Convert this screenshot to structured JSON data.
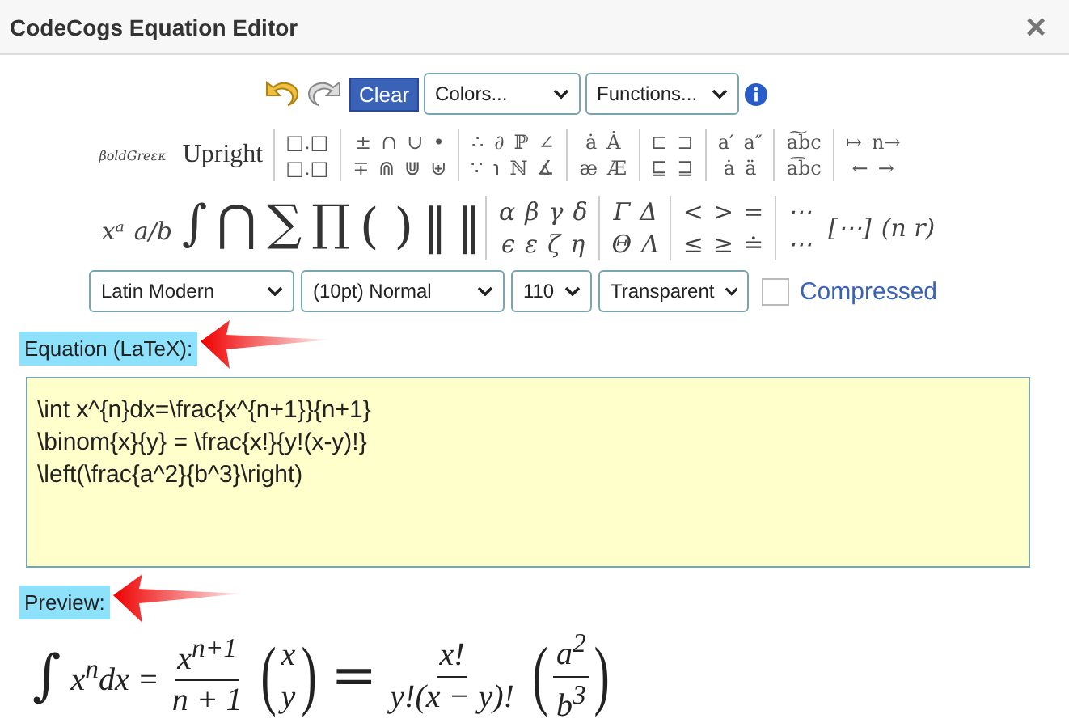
{
  "window": {
    "title": "CodeCogs Equation Editor",
    "close": "×"
  },
  "toolbar": {
    "clear": "Clear",
    "menus": [
      "Colors...",
      "Functions..."
    ]
  },
  "style_buttons": [
    {
      "text": "βoldGreεκ",
      "kind": "small"
    },
    {
      "text": "Upright",
      "kind": "serif"
    }
  ],
  "symbol_groups": [
    {
      "rows": [
        [
          "□.□"
        ],
        [
          "□.□"
        ]
      ]
    },
    {
      "rows": [
        [
          "±",
          "∩",
          "∪",
          "•"
        ],
        [
          "∓",
          "⋒",
          "⋓",
          "⊎"
        ]
      ]
    },
    {
      "rows": [
        [
          "∴",
          "∂",
          "ℙ",
          "∠"
        ],
        [
          "∵",
          "℩",
          "ℕ",
          "∡"
        ]
      ]
    },
    {
      "rows": [
        [
          "ȧ",
          "Ȧ"
        ],
        [
          "æ",
          "Æ"
        ]
      ]
    },
    {
      "rows": [
        [
          "⊏",
          "⊐"
        ],
        [
          "⊑",
          "⊒"
        ]
      ]
    },
    {
      "rows": [
        [
          "a′",
          "a″"
        ],
        [
          "ȧ",
          "ä"
        ]
      ]
    },
    {
      "rows": [
        [
          "a͠bc"
        ],
        [
          "a͡bc"
        ]
      ]
    },
    {
      "rows": [
        [
          "↦",
          "n→"
        ],
        [
          "←",
          "→"
        ]
      ]
    }
  ],
  "big_groups": [
    {
      "items": [
        "xᵃ",
        "a/b",
        "∫",
        "⋂",
        "∑",
        "∏"
      ]
    },
    {
      "items": [
        "( )",
        "‖",
        "‖"
      ]
    },
    {
      "rows": [
        [
          "α",
          "β",
          "γ",
          "δ"
        ],
        [
          "ϵ",
          "ε",
          "ζ",
          "η"
        ]
      ]
    },
    {
      "rows": [
        [
          "Γ",
          "Δ"
        ],
        [
          "Θ",
          "Λ"
        ]
      ]
    },
    {
      "rows": [
        [
          "<",
          ">",
          "="
        ],
        [
          "≤",
          "≥",
          "≐"
        ]
      ]
    },
    {
      "rows": [
        [
          "⋯"
        ],
        [
          "⋯"
        ]
      ]
    },
    {
      "items": [
        "[⋯]",
        "(n r)"
      ]
    }
  ],
  "format": {
    "selects": [
      "Latin Modern",
      "(10pt) Normal",
      "110",
      "Transparent"
    ],
    "compressed": {
      "label": "Compressed",
      "checked": false
    }
  },
  "equation": {
    "label": "Equation (LaTeX):",
    "value": "\\int x^{n}dx=\\frac{x^{n+1}}{n+1}\n\\binom{x}{y} = \\frac{x!}{y!(x-y)!}\n\\left(\\frac{a^2}{b^3}\\right)"
  },
  "preview": {
    "label": "Preview:",
    "parts": [
      {
        "kind": "text",
        "text": "∫"
      },
      {
        "kind": "text",
        "text": "x$^{n}$dx ="
      },
      {
        "kind": "frac",
        "num": "x$^{n+1}$",
        "den": "n + 1"
      },
      {
        "kind": "binom",
        "open": "(",
        "top": "x",
        "bottom": "y",
        "close": ")"
      },
      {
        "kind": "text",
        "text": "="
      },
      {
        "kind": "frac",
        "num": "x!",
        "den": "y!(x − y)!"
      },
      {
        "kind": "pfrac",
        "open": "(",
        "num": "a$^{2}$",
        "den": "b$^{3}$",
        "close": ")"
      }
    ]
  }
}
